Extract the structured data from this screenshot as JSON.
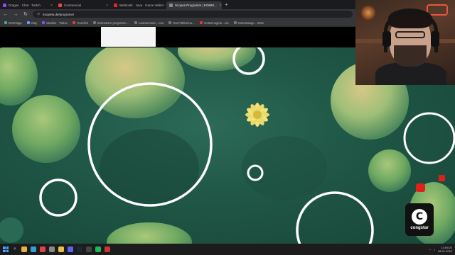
{
  "browser": {
    "tabs": [
      {
        "label": "Dragon · Chat · Twitch",
        "color": "#9146ff",
        "active": false
      },
      {
        "label": "Commercial",
        "color": "#e44",
        "active": false
      },
      {
        "label": "Webtoolk · Java · Game Wallet",
        "color": "#e23",
        "active": false
      },
      {
        "label": "Scopes Programm | KOMM…",
        "color": "#888",
        "active": true
      }
    ],
    "new_tab": "+",
    "nav": {
      "back": "←",
      "forward": "→",
      "reload": "↻"
    },
    "address": "koopeta.de/programm",
    "bookmarks": [
      {
        "label": "DSGVaga",
        "color": "#4a8"
      },
      {
        "label": "Olay",
        "color": "#69f"
      },
      {
        "label": "Stadion · Twitce",
        "color": "#9146ff"
      },
      {
        "label": "YouClick",
        "color": "#e33"
      },
      {
        "label": "Brainstorm programm…",
        "color": "#777"
      },
      {
        "label": "Lowtonmusic…ceo",
        "color": "#777"
      },
      {
        "label": "Tea Poblonma…",
        "color": "#777"
      },
      {
        "label": "Gottvenugelo…via",
        "color": "#e33"
      },
      {
        "label": "Geburtstage…2021",
        "color": "#777"
      }
    ]
  },
  "brand": {
    "logo_glyph": "C",
    "name": "congstar"
  },
  "taskbar": {
    "icons": [
      {
        "name": "explorer-icon",
        "color": "#e6b33c"
      },
      {
        "name": "edge-icon",
        "color": "#2fa0d8"
      },
      {
        "name": "chrome-icon",
        "color": "#d44"
      },
      {
        "name": "terminal-icon",
        "color": "#888"
      },
      {
        "name": "files-icon",
        "color": "#e6c04a"
      },
      {
        "name": "discord-icon",
        "color": "#5865f2"
      },
      {
        "name": "steam-icon",
        "color": "#1b2838"
      },
      {
        "name": "obs-icon",
        "color": "#444"
      },
      {
        "name": "spotify-icon",
        "color": "#1db954"
      },
      {
        "name": "app-icon",
        "color": "#c33"
      }
    ],
    "time": "13:59:23",
    "date": "08.01.2024"
  }
}
